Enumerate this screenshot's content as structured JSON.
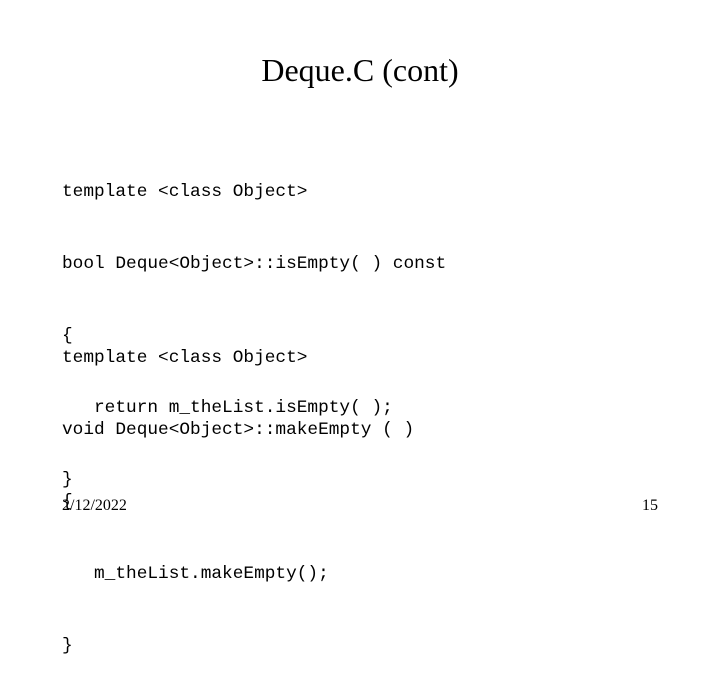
{
  "slide": {
    "title": "Deque.C (cont)",
    "code_blocks": [
      {
        "lines": [
          "template <class Object>",
          "bool Deque<Object>::isEmpty( ) const",
          "{",
          "   return m_theList.isEmpty( );",
          "}"
        ]
      },
      {
        "lines": [
          "template <class Object>",
          "void Deque<Object>::makeEmpty ( )",
          "{",
          "   m_theList.makeEmpty();",
          "}"
        ]
      }
    ],
    "footer": {
      "date": "2/12/2022",
      "page_number": "15"
    }
  }
}
